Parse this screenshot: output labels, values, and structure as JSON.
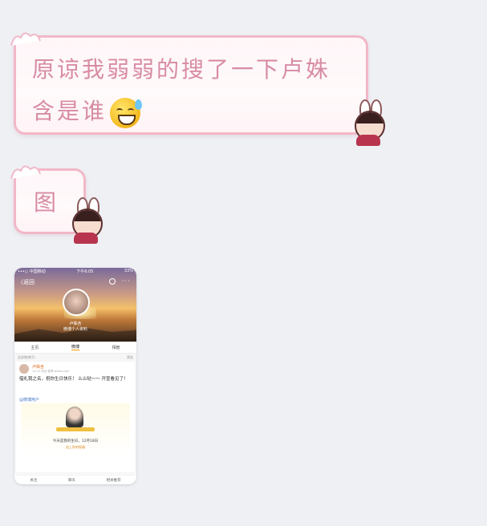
{
  "messages": [
    {
      "text": "原谅我弱弱的搜了一下卢姝含是谁",
      "emoji": "sweat-smile-emoji"
    },
    {
      "text": "图"
    }
  ],
  "phone": {
    "status_left": "•••○ 中国移动",
    "status_center": "下午6:05",
    "status_right": "33%",
    "back_label": "〈返回",
    "profile_name": "卢姝含",
    "profile_sub": "微博个人资料",
    "tabs": [
      "主页",
      "微博",
      "相册"
    ],
    "section_header": "全部微博(5)",
    "section_filter": "筛选",
    "post_name": "卢姝含",
    "post_meta": "10-13 来自 微博 weibo.com",
    "post_text": "借礼我之名，祝你生日快乐！ 么么哒～～ 开宣看见了！",
    "post_link": "@微博用户",
    "card_text": "今天是我的生日，12月18日",
    "card_sub": "送上你的祝福",
    "bottom": [
      "关注",
      "聊天",
      "相关推荐"
    ]
  }
}
